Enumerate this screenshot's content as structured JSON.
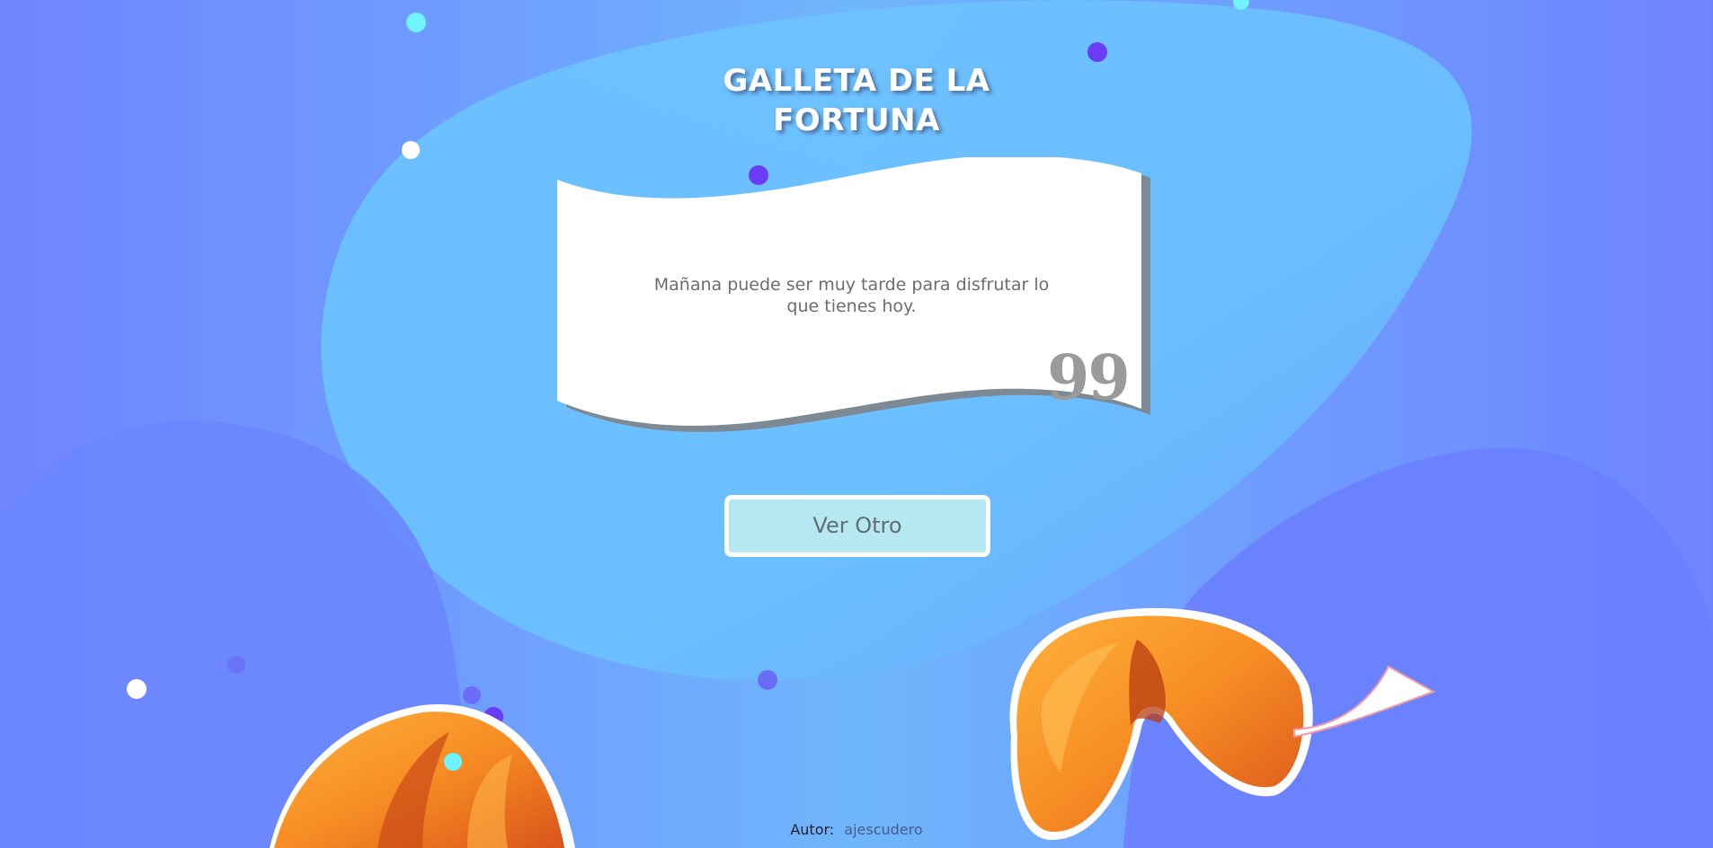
{
  "page": {
    "title_line1": "GALLETA DE LA",
    "title_line2": "FORTUNA"
  },
  "fortune": {
    "message": "Mañana puede ser muy tarde para disfrutar lo que tienes hoy.",
    "quote_mark": "99"
  },
  "actions": {
    "next_label": "Ver Otro"
  },
  "footer": {
    "author_label": "Autor:",
    "author_name": "ajescudero"
  },
  "colors": {
    "background": "#6fa0ff",
    "blob": "#6ec3ff",
    "button_bg": "#b6e8f1",
    "button_border": "#ffffff",
    "cookie": "#f7922a",
    "dot_cyan": "#6ff4ff",
    "dot_purple": "#6a3cf6",
    "dot_white": "#ffffff"
  },
  "icons": {
    "quote": "closing-quote-icon",
    "cookies": "fortune-cookie-icon"
  }
}
